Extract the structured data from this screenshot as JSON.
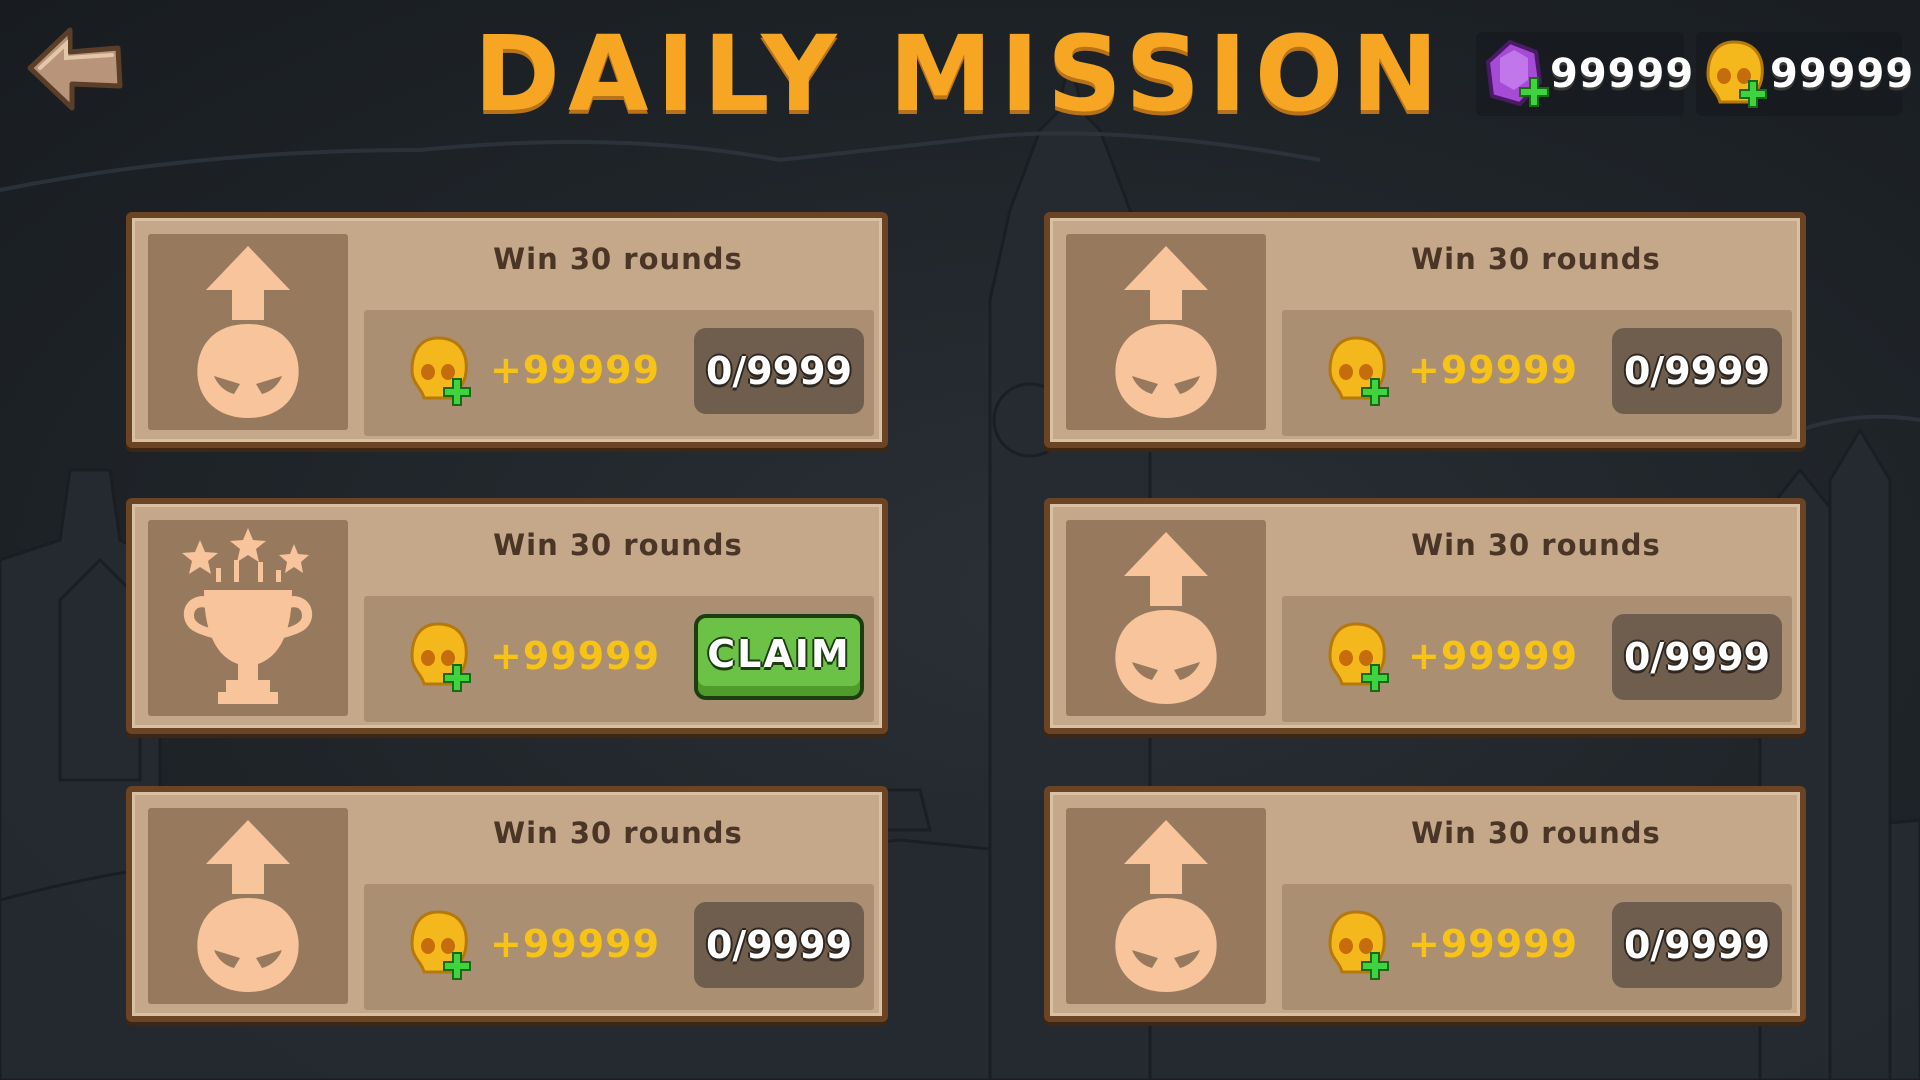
{
  "header": {
    "title": "DAILY MISSION",
    "back_icon": "back-arrow-icon"
  },
  "currencies": {
    "gems": {
      "icon": "purple-gem-icon",
      "amount": "99999",
      "color": "#a64bd6"
    },
    "skulls": {
      "icon": "gold-skull-icon",
      "amount": "99999",
      "color": "#f5b81c"
    }
  },
  "colors": {
    "title": "#f6a623",
    "reward_text": "#f7c316",
    "claim_button": "#6cc246",
    "card": "#c4a889",
    "card_border": "#6a4424"
  },
  "missions": [
    {
      "title": "Win 30 rounds",
      "icon": "upgrade-skull-icon",
      "reward_icon": "gold-skull-icon",
      "reward": "+99999",
      "progress": "0/9999",
      "status": "in-progress"
    },
    {
      "title": "Win 30 rounds",
      "icon": "upgrade-skull-icon",
      "reward_icon": "gold-skull-icon",
      "reward": "+99999",
      "progress": "0/9999",
      "status": "in-progress"
    },
    {
      "title": "Win 30 rounds",
      "icon": "trophy-icon",
      "reward_icon": "gold-skull-icon",
      "reward": "+99999",
      "action_label": "CLAIM",
      "status": "claimable"
    },
    {
      "title": "Win 30 rounds",
      "icon": "upgrade-skull-icon",
      "reward_icon": "gold-skull-icon",
      "reward": "+99999",
      "progress": "0/9999",
      "status": "in-progress"
    },
    {
      "title": "Win 30 rounds",
      "icon": "upgrade-skull-icon",
      "reward_icon": "gold-skull-icon",
      "reward": "+99999",
      "progress": "0/9999",
      "status": "in-progress"
    },
    {
      "title": "Win 30 rounds",
      "icon": "upgrade-skull-icon",
      "reward_icon": "gold-skull-icon",
      "reward": "+99999",
      "progress": "0/9999",
      "status": "in-progress"
    }
  ]
}
